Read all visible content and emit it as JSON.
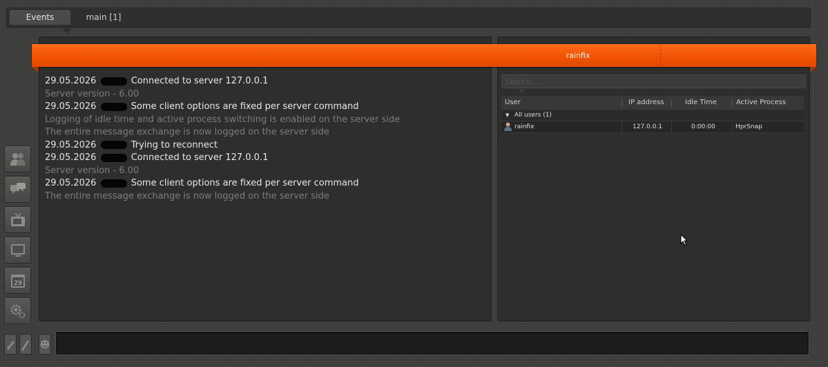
{
  "tabs": [
    {
      "label": "Events",
      "active": true
    },
    {
      "label": "main [1]",
      "active": false
    }
  ],
  "banner": {
    "title": "rainfix",
    "color": "#f05200"
  },
  "events": [
    {
      "date": "29.05.2026",
      "message": "Connected to server 127.0.0.1",
      "kind": "main"
    },
    {
      "text": "Server version - 6.00",
      "kind": "sub"
    },
    {
      "date": "29.05.2026",
      "message": "Some client options are fixed per server command",
      "kind": "main"
    },
    {
      "text": "Logging of idle time and active process switching is enabled on the server side",
      "kind": "sub"
    },
    {
      "text": "The entire message exchange is now logged on the server side",
      "kind": "sub"
    },
    {
      "date": "29.05.2026",
      "message": "Trying to reconnect",
      "kind": "main"
    },
    {
      "date": "29.05.2026",
      "message": "Connected to server 127.0.0.1",
      "kind": "main"
    },
    {
      "text": "Server version - 6.00",
      "kind": "sub"
    },
    {
      "date": "29.05.2026",
      "message": "Some client options are fixed per server command",
      "kind": "main"
    },
    {
      "text": "The entire message exchange is now logged on the server side",
      "kind": "sub"
    }
  ],
  "search": {
    "placeholder": "Search..."
  },
  "users_table": {
    "columns": [
      "User",
      "IP address",
      "Idle Time",
      "Active Process"
    ],
    "group": "All users (1)",
    "rows": [
      {
        "user": "rainfix",
        "ip": "127.0.0.1",
        "idle": "0:00:00",
        "process": "HprSnap"
      }
    ]
  },
  "sidebar": {
    "icons": [
      "users-icon",
      "chat-icon",
      "tv-icon",
      "monitor-icon",
      "calendar-icon",
      "settings-icon"
    ],
    "calendar_day": "29"
  },
  "bottom_buttons": [
    "edit-icon",
    "pen-icon",
    "smiley-icon"
  ]
}
